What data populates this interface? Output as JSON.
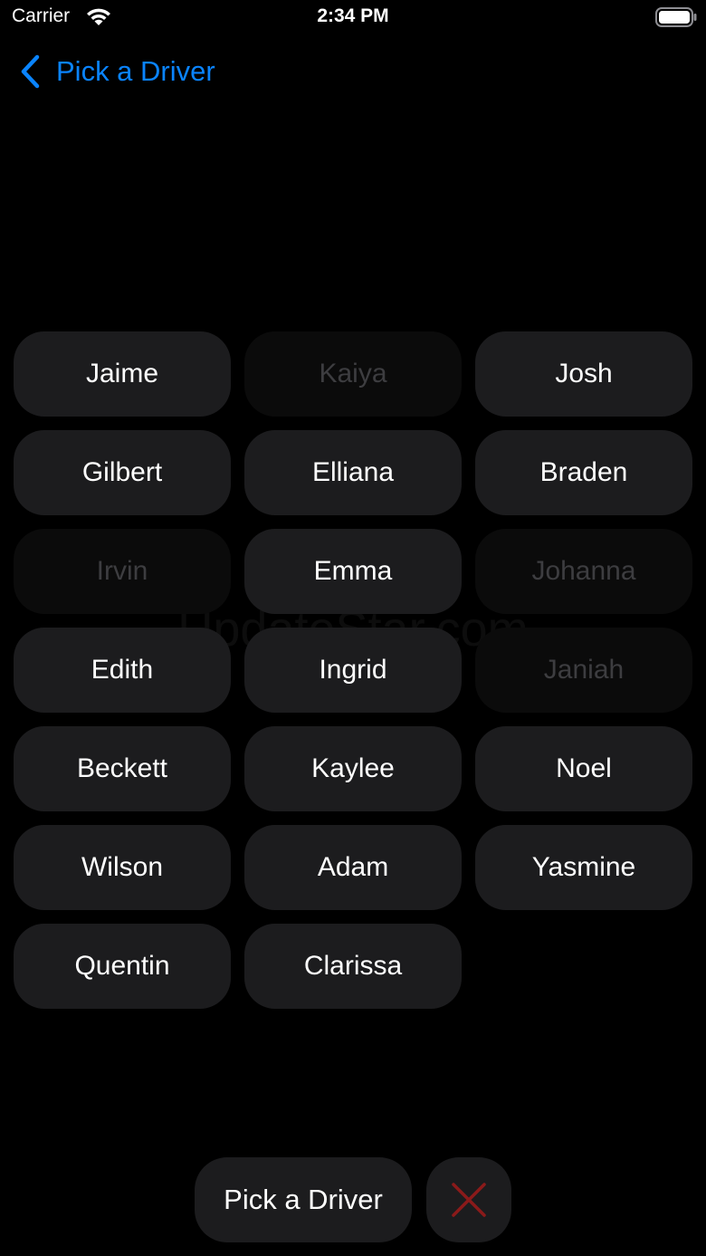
{
  "status_bar": {
    "carrier": "Carrier",
    "time": "2:34 PM",
    "wifi_icon": "wifi-icon",
    "battery_icon": "battery-icon"
  },
  "nav": {
    "back_label": "Pick a Driver",
    "back_icon": "chevron-left-icon",
    "accent_color": "#0a84ff"
  },
  "drivers": [
    {
      "name": "Jaime",
      "enabled": true
    },
    {
      "name": "Kaiya",
      "enabled": false
    },
    {
      "name": "Josh",
      "enabled": true
    },
    {
      "name": "Gilbert",
      "enabled": true
    },
    {
      "name": "Elliana",
      "enabled": true
    },
    {
      "name": "Braden",
      "enabled": true
    },
    {
      "name": "Irvin",
      "enabled": false
    },
    {
      "name": "Emma",
      "enabled": true
    },
    {
      "name": "Johanna",
      "enabled": false
    },
    {
      "name": "Edith",
      "enabled": true
    },
    {
      "name": "Ingrid",
      "enabled": true
    },
    {
      "name": "Janiah",
      "enabled": false
    },
    {
      "name": "Beckett",
      "enabled": true
    },
    {
      "name": "Kaylee",
      "enabled": true
    },
    {
      "name": "Noel",
      "enabled": true
    },
    {
      "name": "Wilson",
      "enabled": true
    },
    {
      "name": "Adam",
      "enabled": true
    },
    {
      "name": "Yasmine",
      "enabled": true
    },
    {
      "name": "Quentin",
      "enabled": true
    },
    {
      "name": "Clarissa",
      "enabled": true
    }
  ],
  "watermark": "UpdateStar.com",
  "actions": {
    "pick_label": "Pick a Driver",
    "clear_icon": "close-icon",
    "clear_icon_color": "#8b1a1a"
  },
  "colors": {
    "background": "#000000",
    "chip": "#1c1c1e",
    "chip_dimmed": "#0b0b0b",
    "chip_dimmed_text": "#3d3d40"
  }
}
